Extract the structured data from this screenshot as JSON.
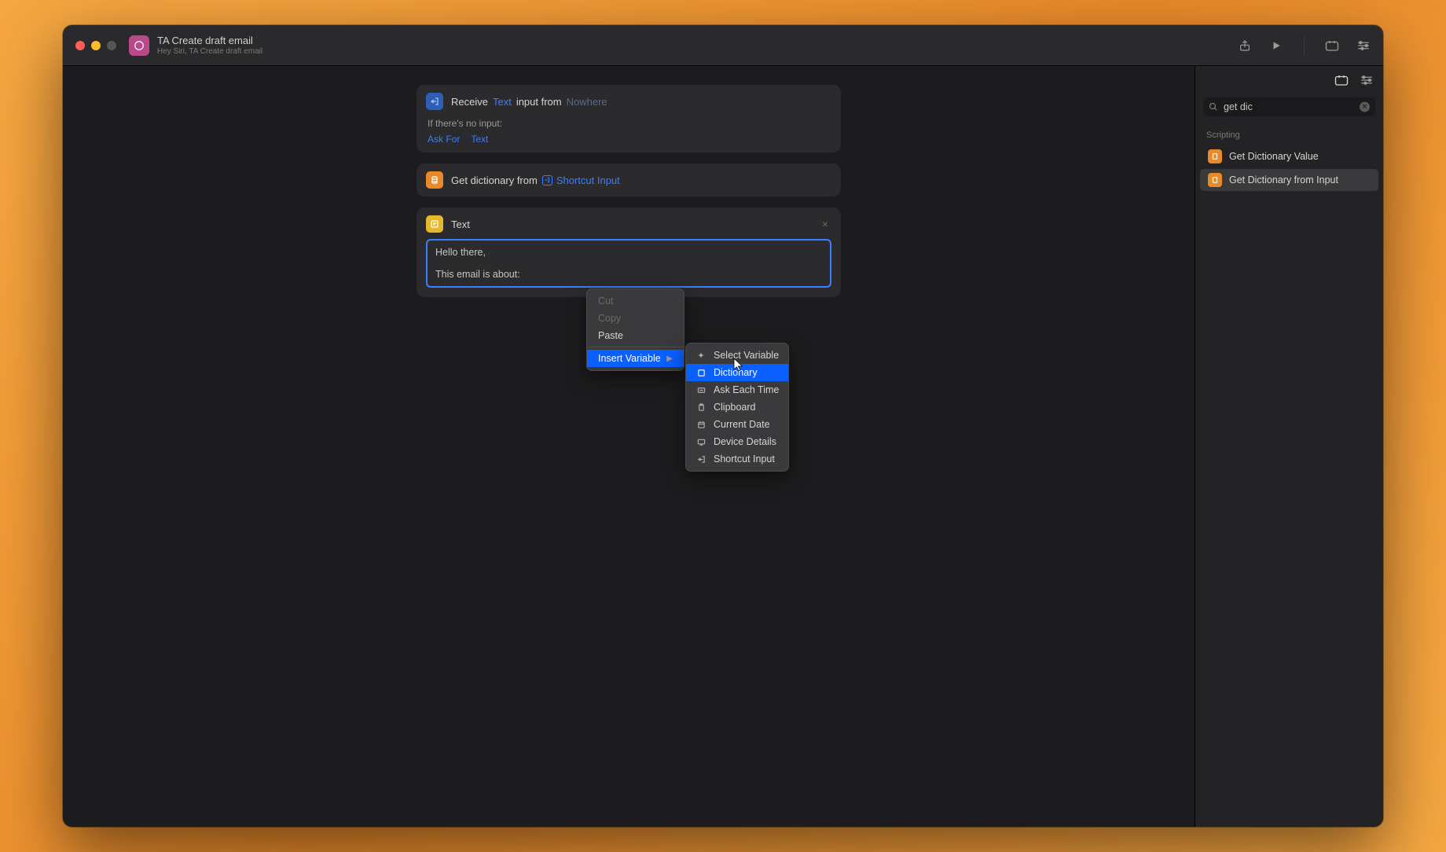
{
  "titlebar": {
    "title": "TA Create draft email",
    "subtitle": "Hey Siri, TA Create draft email"
  },
  "actions": {
    "receive": {
      "label": "Receive",
      "type_link": "Text",
      "mid_text": "input from",
      "source_placeholder": "Nowhere",
      "no_input_label": "If there's no input:",
      "ask_for": "Ask For",
      "ask_for_type": "Text"
    },
    "get_dictionary": {
      "label": "Get dictionary from",
      "input_label": "Shortcut Input"
    },
    "text": {
      "label": "Text",
      "content": "Hello there,\n\nThis email is about:"
    }
  },
  "context_menu": {
    "cut": "Cut",
    "copy": "Copy",
    "paste": "Paste",
    "insert_variable": "Insert Variable"
  },
  "variable_submenu": {
    "select_variable": "Select Variable",
    "dictionary": "Dictionary",
    "ask_each_time": "Ask Each Time",
    "clipboard": "Clipboard",
    "current_date": "Current Date",
    "device_details": "Device Details",
    "shortcut_input": "Shortcut Input"
  },
  "sidebar": {
    "search_value": "get dic",
    "section_label": "Scripting",
    "results": [
      {
        "label": "Get Dictionary Value"
      },
      {
        "label": "Get Dictionary from Input"
      }
    ]
  }
}
